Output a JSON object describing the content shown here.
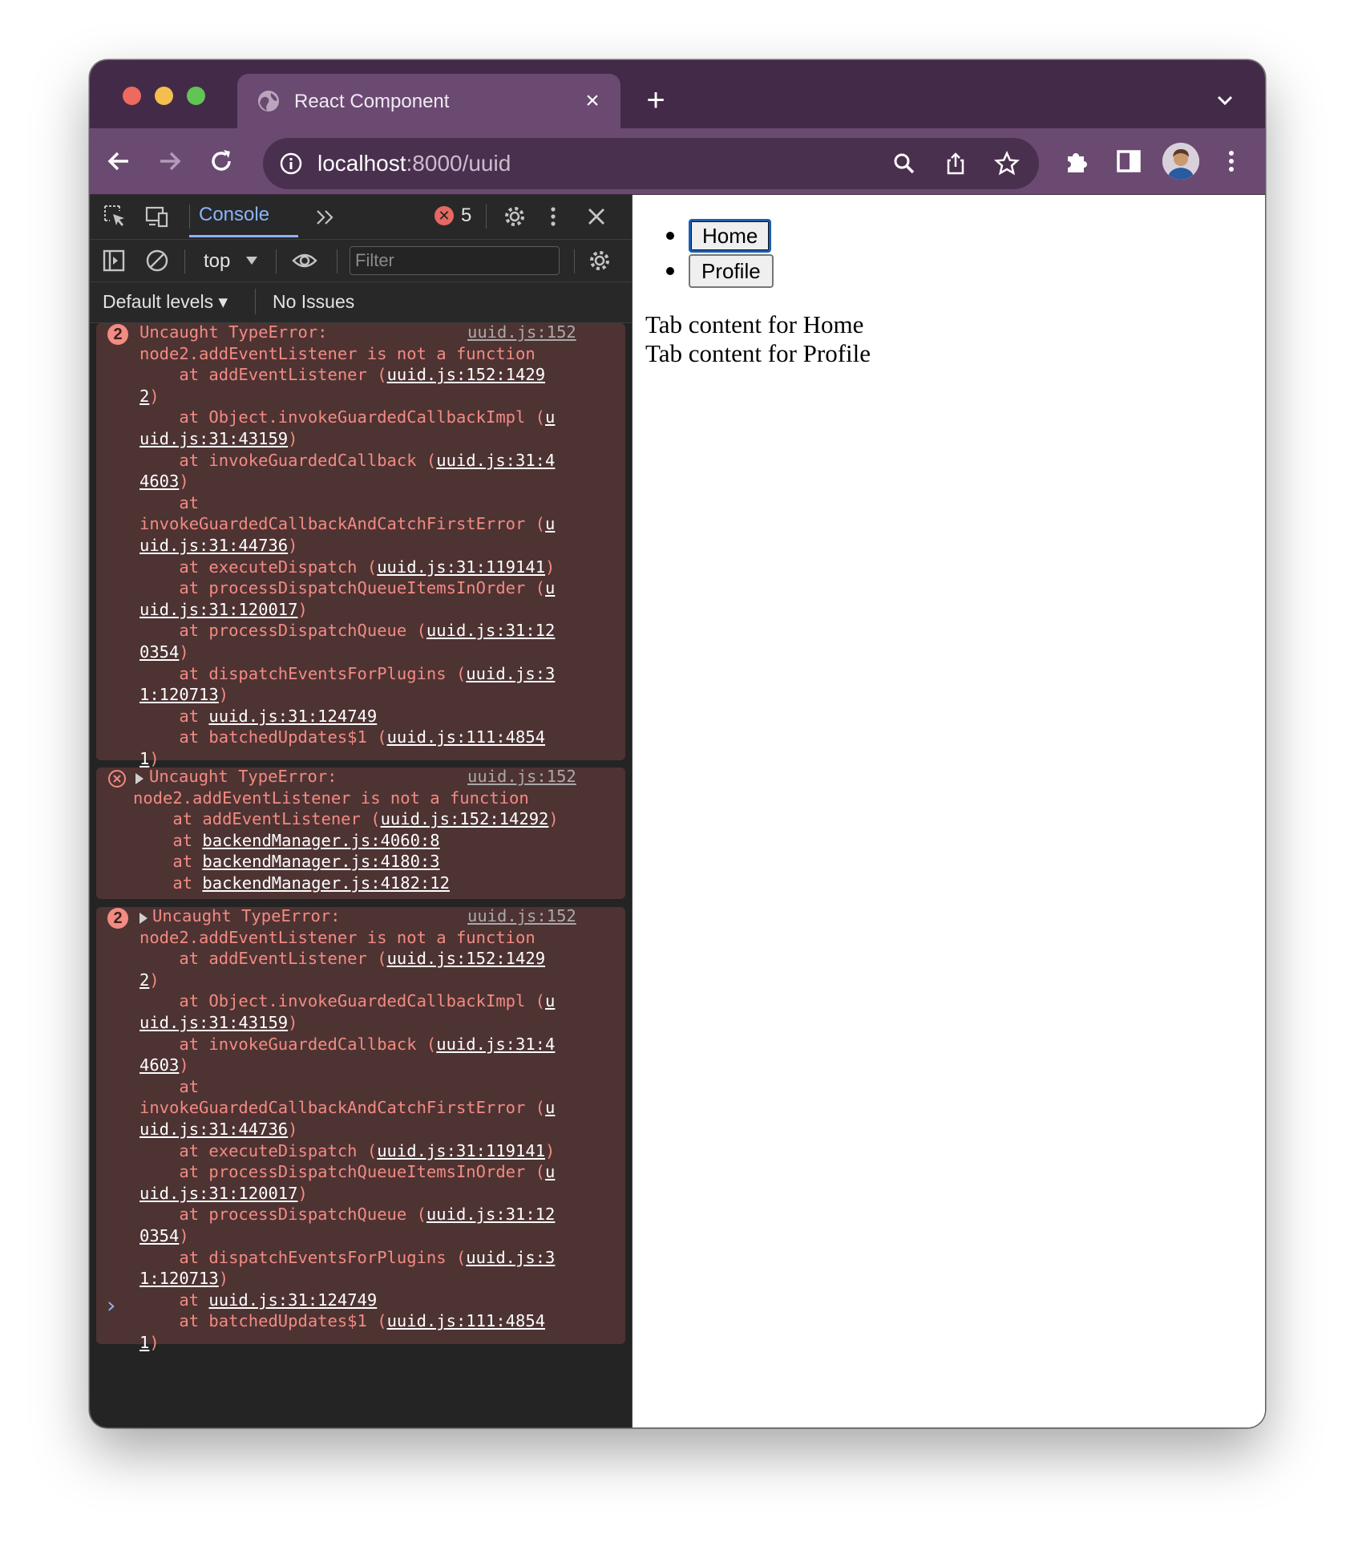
{
  "browser": {
    "tab_title": "React Component",
    "url_host": "localhost",
    "url_path": ":8000/uuid",
    "colors": {
      "frame": "#432a48",
      "toolbar": "#6b4a72",
      "omnibox": "#4a304f"
    }
  },
  "devtools": {
    "console_tab": "Console",
    "error_count": "5",
    "context": "top",
    "filter_placeholder": "Filter",
    "levels": "Default levels",
    "issues": "No Issues",
    "messages": [
      {
        "badge": "2",
        "lines": [
          "Uncaught TypeError:",
          "node2.addEventListener is not a function",
          "    at addEventListener (",
          "uuid.js:152:1429",
          "2",
          "    at Object.invokeGuardedCallbackImpl (",
          "u",
          "uid.js:31:43159",
          "    at invokeGuardedCallback (",
          "uuid.js:31:4",
          "4603",
          "    at",
          "invokeGuardedCallbackAndCatchFirstError (",
          "u",
          "uid.js:31:44736",
          "    at executeDispatch (",
          "uuid.js:31:119141",
          "    at processDispatchQueueItemsInOrder (",
          "u",
          "uid.js:31:120017",
          "    at processDispatchQueue (",
          "uuid.js:31:12",
          "0354",
          "    at dispatchEventsForPlugins (",
          "uuid.js:3",
          "1:120713",
          "    at ",
          "uuid.js:31:124749",
          "    at batchedUpdates$1 (",
          "uuid.js:111:4854",
          "1"
        ],
        "source": "uuid.js:152"
      },
      {
        "lines": [
          "Uncaught TypeError:",
          "node2.addEventListener is not a function",
          "    at addEventListener (",
          "uuid.js:152:14292",
          "    at ",
          "backendManager.js:4060:8",
          "backendManager.js:4180:3",
          "backendManager.js:4182:12"
        ],
        "source": "uuid.js:152"
      },
      {
        "badge": "2",
        "source": "uuid.js:152"
      }
    ]
  },
  "page": {
    "tabs": [
      "Home",
      "Profile"
    ],
    "content": [
      "Tab content for Home",
      "Tab content for Profile"
    ]
  }
}
